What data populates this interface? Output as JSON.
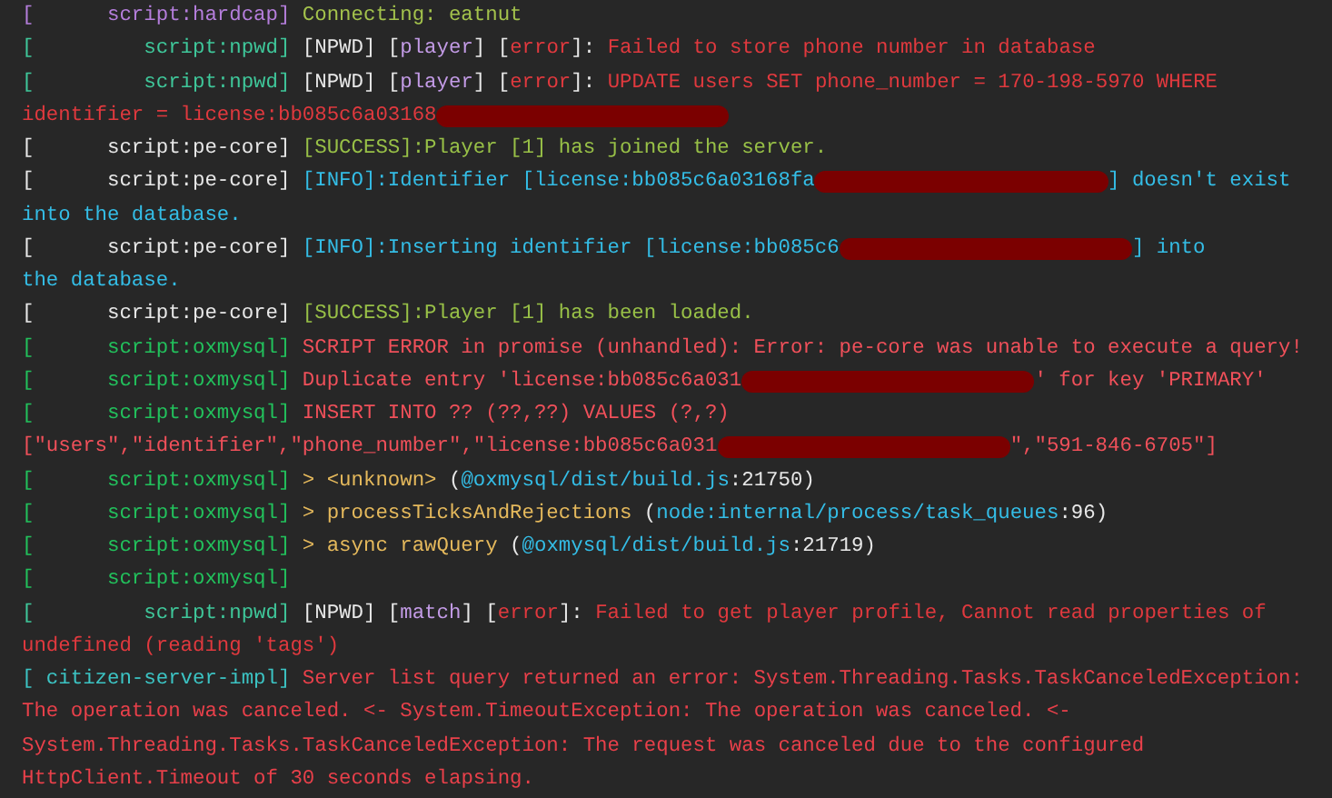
{
  "lines": [
    {
      "prefix": "[      script:hardcap]",
      "color": "#b57edc",
      "rows": [
        [
          {
            "text": "Connecting: eatnut",
            "color": "#a3c24c"
          }
        ]
      ]
    },
    {
      "prefix": "[         script:npwd]",
      "color": "#3fc79a",
      "rows": [
        [
          {
            "text": "[NPWD] [",
            "color": "#e8e8e8"
          },
          {
            "text": "player",
            "color": "#c39be6"
          },
          {
            "text": "] [",
            "color": "#e8e8e8"
          },
          {
            "text": "error",
            "color": "#e0393e"
          },
          {
            "text": "]: ",
            "color": "#e8e8e8"
          },
          {
            "text": "Failed to store phone number in database",
            "color": "#e0393e"
          }
        ]
      ]
    },
    {
      "prefix": "[         script:npwd]",
      "color": "#3fc79a",
      "rows": [
        [
          {
            "text": "[NPWD] [",
            "color": "#e8e8e8"
          },
          {
            "text": "player",
            "color": "#c39be6"
          },
          {
            "text": "] [",
            "color": "#e8e8e8"
          },
          {
            "text": "error",
            "color": "#e0393e"
          },
          {
            "text": "]: ",
            "color": "#e8e8e8"
          },
          {
            "text": "UPDATE users SET phone_number = 170-198-5970 WHERE",
            "color": "#e0393e"
          }
        ],
        [
          {
            "text": "identifier = license:bb085c6a03168",
            "color": "#e0393e"
          },
          {
            "kind": "redaction"
          }
        ]
      ]
    },
    {
      "prefix": "[      script:pe-core]",
      "color": "#e8e8e8",
      "rows": [
        [
          {
            "text": "[SUCCESS]:Player [1] has joined the server.",
            "color": "#98c047"
          }
        ]
      ]
    },
    {
      "prefix": "[      script:pe-core]",
      "color": "#e8e8e8",
      "rows": [
        [
          {
            "text": "[INFO]:Identifier [license:bb085c6a03168fa",
            "color": "#34bde6"
          },
          {
            "kind": "redaction"
          },
          {
            "text": "] doesn't exist",
            "color": "#34bde6"
          }
        ],
        [
          {
            "text": "into the database.",
            "color": "#34bde6"
          }
        ]
      ]
    },
    {
      "prefix": "[      script:pe-core]",
      "color": "#e8e8e8",
      "rows": [
        [
          {
            "text": "[INFO]:Inserting identifier [license:bb085c6",
            "color": "#34bde6"
          },
          {
            "kind": "redaction"
          },
          {
            "text": "] into",
            "color": "#34bde6"
          }
        ],
        [
          {
            "text": "the database.",
            "color": "#34bde6"
          }
        ]
      ]
    },
    {
      "prefix": "[      script:pe-core]",
      "color": "#e8e8e8",
      "rows": [
        [
          {
            "text": "[SUCCESS]:Player [1] has been loaded.",
            "color": "#98c047"
          }
        ]
      ]
    },
    {
      "prefix": "[      script:oxmysql]",
      "color": "#22c15c",
      "rows": [
        [
          {
            "text": "SCRIPT ERROR in promise (unhandled): Error: pe-core was unable to execute a query!",
            "color": "#f0505a"
          }
        ]
      ]
    },
    {
      "prefix": "[      script:oxmysql]",
      "color": "#22c15c",
      "rows": [
        [
          {
            "text": "Duplicate entry 'license:bb085c6a031",
            "color": "#f0505a"
          },
          {
            "kind": "redaction"
          },
          {
            "text": "' for key 'PRIMARY'",
            "color": "#f0505a"
          }
        ]
      ]
    },
    {
      "prefix": "[      script:oxmysql]",
      "color": "#22c15c",
      "rows": [
        [
          {
            "text": "INSERT INTO ?? (??,??) VALUES (?,?)",
            "color": "#f0505a"
          }
        ],
        [
          {
            "text": "[\"users\",\"identifier\",\"phone_number\",\"license:bb085c6a031",
            "color": "#f0505a"
          },
          {
            "kind": "redaction"
          },
          {
            "text": "\",\"591-846-6705\"]",
            "color": "#f0505a"
          }
        ]
      ]
    },
    {
      "prefix": "[      script:oxmysql]",
      "color": "#22c15c",
      "rows": [
        [
          {
            "text": "> <unknown>",
            "color": "#e5b95c"
          },
          {
            "text": " (",
            "color": "#e8e8e8"
          },
          {
            "text": "@oxmysql/dist/build.js",
            "color": "#34bde6"
          },
          {
            "text": ":21750)",
            "color": "#e8e8e8"
          }
        ]
      ]
    },
    {
      "prefix": "[      script:oxmysql]",
      "color": "#22c15c",
      "rows": [
        [
          {
            "text": "> processTicksAndRejections",
            "color": "#e5b95c"
          },
          {
            "text": " (",
            "color": "#e8e8e8"
          },
          {
            "text": "node:internal/process/task_queues",
            "color": "#34bde6"
          },
          {
            "text": ":96)",
            "color": "#e8e8e8"
          }
        ]
      ]
    },
    {
      "prefix": "[      script:oxmysql]",
      "color": "#22c15c",
      "rows": [
        [
          {
            "text": "> async rawQuery",
            "color": "#e5b95c"
          },
          {
            "text": " (",
            "color": "#e8e8e8"
          },
          {
            "text": "@oxmysql/dist/build.js",
            "color": "#34bde6"
          },
          {
            "text": ":21719)",
            "color": "#e8e8e8"
          }
        ]
      ]
    },
    {
      "prefix": "[      script:oxmysql]",
      "color": "#22c15c"
    },
    {
      "prefix": "[         script:npwd]",
      "color": "#3fc79a",
      "rows": [
        [
          {
            "text": "[NPWD] [",
            "color": "#e8e8e8"
          },
          {
            "text": "match",
            "color": "#c39be6"
          },
          {
            "text": "] [",
            "color": "#e8e8e8"
          },
          {
            "text": "error",
            "color": "#e0393e"
          },
          {
            "text": "]: ",
            "color": "#e8e8e8"
          },
          {
            "text": "Failed to get player profile, Cannot read properties of",
            "color": "#e0393e"
          }
        ],
        [
          {
            "text": "undefined (reading 'tags')",
            "color": "#e0393e"
          }
        ]
      ]
    },
    {
      "prefix": "[ citizen-server-impl]",
      "color": "#3cc4c4",
      "rows": [
        [
          {
            "text": "Server list query returned an error: System.Threading.Tasks.TaskCanceledException:",
            "color": "#e8404a"
          }
        ],
        [
          {
            "text": "The operation was canceled. <- System.TimeoutException: The operation was canceled. <-",
            "color": "#e8404a"
          }
        ],
        [
          {
            "text": "System.Threading.Tasks.TaskCanceledException: The request was canceled due to the configured",
            "color": "#e8404a"
          }
        ],
        [
          {
            "text": "HttpClient.Timeout of 30 seconds elapsing.",
            "color": "#e8404a"
          }
        ]
      ]
    }
  ]
}
